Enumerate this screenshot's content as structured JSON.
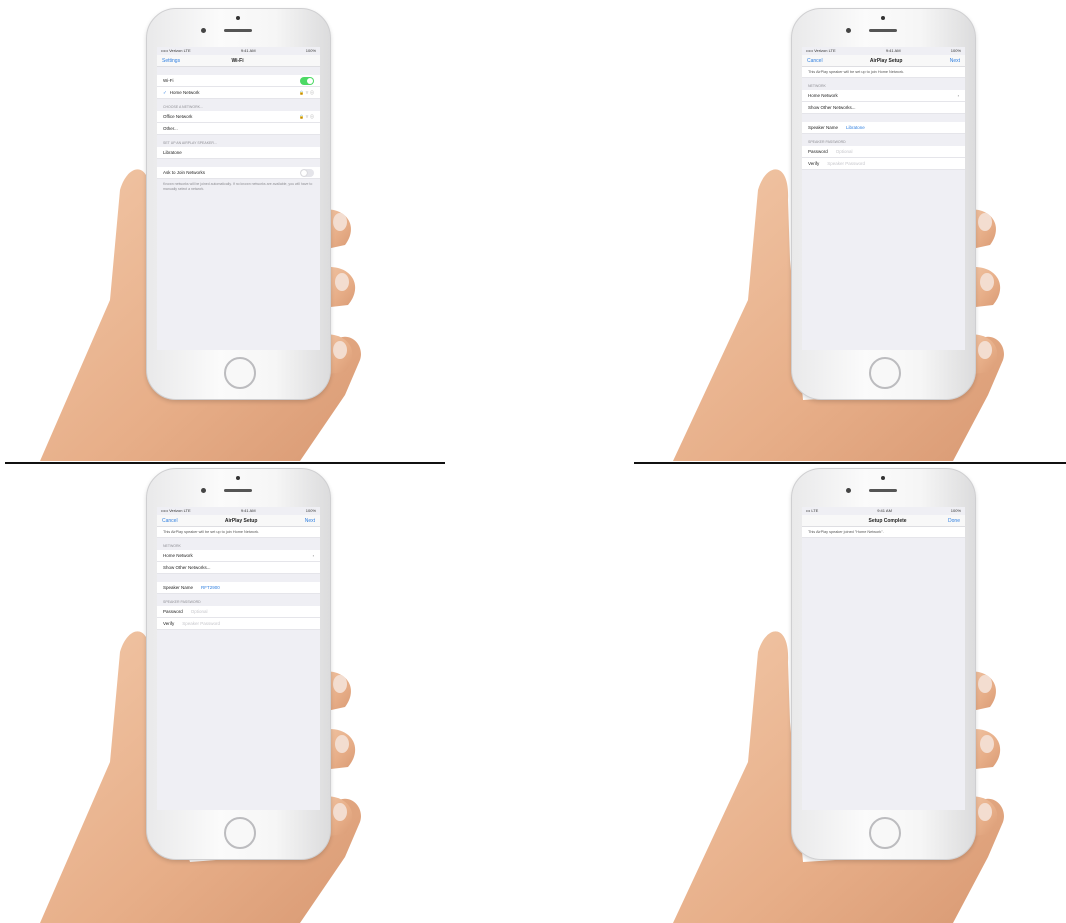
{
  "panels": [
    {
      "id": "wifi-list",
      "status": {
        "carrier": "••••• Verizon LTE",
        "time": "9:41 AM",
        "battery": "100%"
      },
      "nav": {
        "back": "Settings",
        "title": "Wi-Fi",
        "action": ""
      },
      "wifi_label": "Wi-Fi",
      "connected_network": "Home Network",
      "choose_label": "CHOOSE A NETWORK...",
      "networks": [
        "Office Network",
        "Other..."
      ],
      "setup_label": "SET UP AN AIRPLAY SPEAKER...",
      "speaker_name": "Libratone",
      "ask_label": "Ask to Join Networks",
      "ask_note": "Known networks will be joined automatically. If no known networks are available, you will have to manually select a network."
    },
    {
      "id": "airplay-setup-1",
      "status": {
        "carrier": "••••• Verizon LTE",
        "time": "9:41 AM",
        "battery": "100%"
      },
      "nav": {
        "back": "Cancel",
        "title": "AirPlay Setup",
        "action": "Next"
      },
      "banner": "This AirPlay speaker will be set up to join Home Network.",
      "network_label": "NETWORK",
      "network_value": "Home Network",
      "show_other": "Show Other Networks...",
      "speaker_name_label": "Speaker Name",
      "speaker_name_value": "Libratone",
      "password_section": "SPEAKER PASSWORD",
      "password_label": "Password",
      "password_placeholder": "Optional",
      "verify_label": "Verify",
      "verify_placeholder": "Speaker Password"
    },
    {
      "id": "airplay-setup-2",
      "status": {
        "carrier": "••••• Verizon LTE",
        "time": "9:41 AM",
        "battery": "100%"
      },
      "nav": {
        "back": "Cancel",
        "title": "AirPlay Setup",
        "action": "Next"
      },
      "banner": "This AirPlay speaker will be set up to join Home Network.",
      "network_label": "NETWORK",
      "network_value": "Home Network",
      "show_other": "Show Other Networks...",
      "speaker_name_label": "Speaker Name",
      "speaker_name_value": "RFT2900",
      "password_section": "SPEAKER PASSWORD",
      "password_label": "Password",
      "password_placeholder": "Optional",
      "verify_label": "Verify",
      "verify_placeholder": "Speaker Password"
    },
    {
      "id": "setup-complete",
      "status": {
        "carrier": "••• LTE",
        "time": "9:41 AM",
        "battery": "100%"
      },
      "nav": {
        "back": "",
        "title": "Setup Complete",
        "action": "Done"
      },
      "message": "This AirPlay speaker joined \"Home Network\"."
    }
  ]
}
